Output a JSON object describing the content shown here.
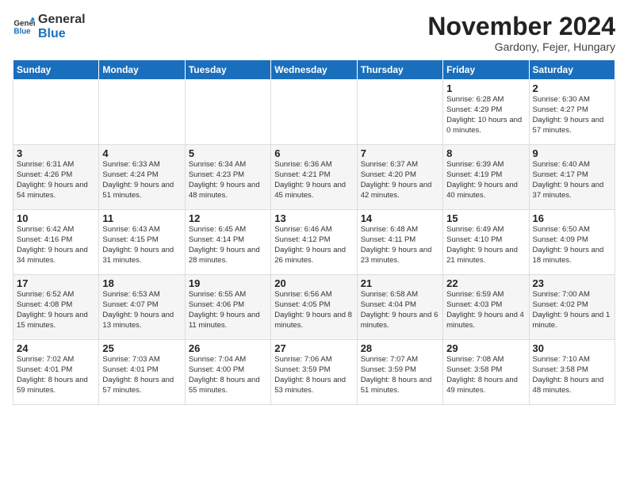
{
  "logo": {
    "line1": "General",
    "line2": "Blue"
  },
  "header": {
    "month": "November 2024",
    "location": "Gardony, Fejer, Hungary"
  },
  "weekdays": [
    "Sunday",
    "Monday",
    "Tuesday",
    "Wednesday",
    "Thursday",
    "Friday",
    "Saturday"
  ],
  "weeks": [
    [
      {
        "day": "",
        "sunrise": "",
        "sunset": "",
        "daylight": ""
      },
      {
        "day": "",
        "sunrise": "",
        "sunset": "",
        "daylight": ""
      },
      {
        "day": "",
        "sunrise": "",
        "sunset": "",
        "daylight": ""
      },
      {
        "day": "",
        "sunrise": "",
        "sunset": "",
        "daylight": ""
      },
      {
        "day": "",
        "sunrise": "",
        "sunset": "",
        "daylight": ""
      },
      {
        "day": "1",
        "sunrise": "Sunrise: 6:28 AM",
        "sunset": "Sunset: 4:29 PM",
        "daylight": "Daylight: 10 hours and 0 minutes."
      },
      {
        "day": "2",
        "sunrise": "Sunrise: 6:30 AM",
        "sunset": "Sunset: 4:27 PM",
        "daylight": "Daylight: 9 hours and 57 minutes."
      }
    ],
    [
      {
        "day": "3",
        "sunrise": "Sunrise: 6:31 AM",
        "sunset": "Sunset: 4:26 PM",
        "daylight": "Daylight: 9 hours and 54 minutes."
      },
      {
        "day": "4",
        "sunrise": "Sunrise: 6:33 AM",
        "sunset": "Sunset: 4:24 PM",
        "daylight": "Daylight: 9 hours and 51 minutes."
      },
      {
        "day": "5",
        "sunrise": "Sunrise: 6:34 AM",
        "sunset": "Sunset: 4:23 PM",
        "daylight": "Daylight: 9 hours and 48 minutes."
      },
      {
        "day": "6",
        "sunrise": "Sunrise: 6:36 AM",
        "sunset": "Sunset: 4:21 PM",
        "daylight": "Daylight: 9 hours and 45 minutes."
      },
      {
        "day": "7",
        "sunrise": "Sunrise: 6:37 AM",
        "sunset": "Sunset: 4:20 PM",
        "daylight": "Daylight: 9 hours and 42 minutes."
      },
      {
        "day": "8",
        "sunrise": "Sunrise: 6:39 AM",
        "sunset": "Sunset: 4:19 PM",
        "daylight": "Daylight: 9 hours and 40 minutes."
      },
      {
        "day": "9",
        "sunrise": "Sunrise: 6:40 AM",
        "sunset": "Sunset: 4:17 PM",
        "daylight": "Daylight: 9 hours and 37 minutes."
      }
    ],
    [
      {
        "day": "10",
        "sunrise": "Sunrise: 6:42 AM",
        "sunset": "Sunset: 4:16 PM",
        "daylight": "Daylight: 9 hours and 34 minutes."
      },
      {
        "day": "11",
        "sunrise": "Sunrise: 6:43 AM",
        "sunset": "Sunset: 4:15 PM",
        "daylight": "Daylight: 9 hours and 31 minutes."
      },
      {
        "day": "12",
        "sunrise": "Sunrise: 6:45 AM",
        "sunset": "Sunset: 4:14 PM",
        "daylight": "Daylight: 9 hours and 28 minutes."
      },
      {
        "day": "13",
        "sunrise": "Sunrise: 6:46 AM",
        "sunset": "Sunset: 4:12 PM",
        "daylight": "Daylight: 9 hours and 26 minutes."
      },
      {
        "day": "14",
        "sunrise": "Sunrise: 6:48 AM",
        "sunset": "Sunset: 4:11 PM",
        "daylight": "Daylight: 9 hours and 23 minutes."
      },
      {
        "day": "15",
        "sunrise": "Sunrise: 6:49 AM",
        "sunset": "Sunset: 4:10 PM",
        "daylight": "Daylight: 9 hours and 21 minutes."
      },
      {
        "day": "16",
        "sunrise": "Sunrise: 6:50 AM",
        "sunset": "Sunset: 4:09 PM",
        "daylight": "Daylight: 9 hours and 18 minutes."
      }
    ],
    [
      {
        "day": "17",
        "sunrise": "Sunrise: 6:52 AM",
        "sunset": "Sunset: 4:08 PM",
        "daylight": "Daylight: 9 hours and 15 minutes."
      },
      {
        "day": "18",
        "sunrise": "Sunrise: 6:53 AM",
        "sunset": "Sunset: 4:07 PM",
        "daylight": "Daylight: 9 hours and 13 minutes."
      },
      {
        "day": "19",
        "sunrise": "Sunrise: 6:55 AM",
        "sunset": "Sunset: 4:06 PM",
        "daylight": "Daylight: 9 hours and 11 minutes."
      },
      {
        "day": "20",
        "sunrise": "Sunrise: 6:56 AM",
        "sunset": "Sunset: 4:05 PM",
        "daylight": "Daylight: 9 hours and 8 minutes."
      },
      {
        "day": "21",
        "sunrise": "Sunrise: 6:58 AM",
        "sunset": "Sunset: 4:04 PM",
        "daylight": "Daylight: 9 hours and 6 minutes."
      },
      {
        "day": "22",
        "sunrise": "Sunrise: 6:59 AM",
        "sunset": "Sunset: 4:03 PM",
        "daylight": "Daylight: 9 hours and 4 minutes."
      },
      {
        "day": "23",
        "sunrise": "Sunrise: 7:00 AM",
        "sunset": "Sunset: 4:02 PM",
        "daylight": "Daylight: 9 hours and 1 minute."
      }
    ],
    [
      {
        "day": "24",
        "sunrise": "Sunrise: 7:02 AM",
        "sunset": "Sunset: 4:01 PM",
        "daylight": "Daylight: 8 hours and 59 minutes."
      },
      {
        "day": "25",
        "sunrise": "Sunrise: 7:03 AM",
        "sunset": "Sunset: 4:01 PM",
        "daylight": "Daylight: 8 hours and 57 minutes."
      },
      {
        "day": "26",
        "sunrise": "Sunrise: 7:04 AM",
        "sunset": "Sunset: 4:00 PM",
        "daylight": "Daylight: 8 hours and 55 minutes."
      },
      {
        "day": "27",
        "sunrise": "Sunrise: 7:06 AM",
        "sunset": "Sunset: 3:59 PM",
        "daylight": "Daylight: 8 hours and 53 minutes."
      },
      {
        "day": "28",
        "sunrise": "Sunrise: 7:07 AM",
        "sunset": "Sunset: 3:59 PM",
        "daylight": "Daylight: 8 hours and 51 minutes."
      },
      {
        "day": "29",
        "sunrise": "Sunrise: 7:08 AM",
        "sunset": "Sunset: 3:58 PM",
        "daylight": "Daylight: 8 hours and 49 minutes."
      },
      {
        "day": "30",
        "sunrise": "Sunrise: 7:10 AM",
        "sunset": "Sunset: 3:58 PM",
        "daylight": "Daylight: 8 hours and 48 minutes."
      }
    ]
  ]
}
